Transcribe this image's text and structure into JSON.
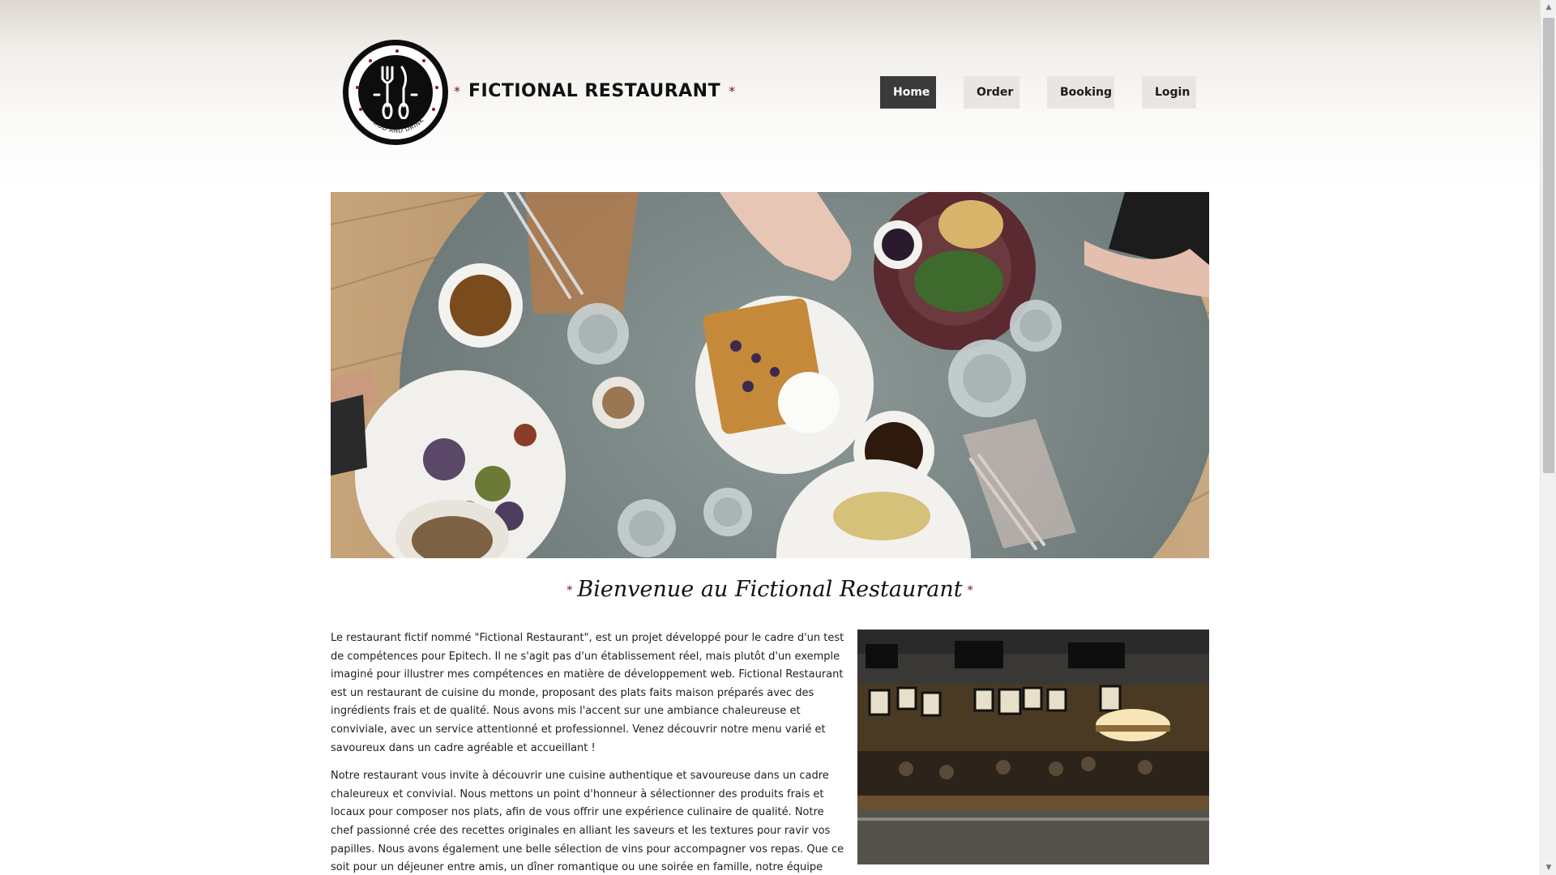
{
  "header": {
    "logo_text": "FOOD AND DRINK",
    "brand_name": "FICTIONAL RESTAURANT",
    "brand_star": "*"
  },
  "nav": {
    "items": [
      {
        "label": "Home",
        "active": true
      },
      {
        "label": "Order",
        "active": false
      },
      {
        "label": "Booking",
        "active": false
      },
      {
        "label": "Login",
        "active": false
      }
    ]
  },
  "welcome": {
    "title": "Bienvenue au Fictional Restaurant",
    "star": "*"
  },
  "content": {
    "paragraphs": [
      "Le restaurant fictif nommé \"Fictional Restaurant\", est un projet développé pour le cadre d'un test de compétences pour Epitech. Il ne s'agit pas d'un établissement réel, mais plutôt d'un exemple imaginé pour illustrer mes compétences en matière de développement web. Fictional Restaurant est un restaurant de cuisine du monde, proposant des plats faits maison préparés avec des ingrédients frais et de qualité. Nous avons mis l'accent sur une ambiance chaleureuse et conviviale, avec un service attentionné et professionnel. Venez découvrir notre menu varié et savoureux dans un cadre agréable et accueillant !",
      "Notre restaurant vous invite à découvrir une cuisine authentique et savoureuse dans un cadre chaleureux et convivial. Nous mettons un point d'honneur à sélectionner des produits frais et locaux pour composer nos plats, afin de vous offrir une expérience culinaire de qualité. Notre chef passionné crée des recettes originales en alliant les saveurs et les textures pour ravir vos papilles. Nous avons également une belle sélection de vins pour accompagner vos repas. Que ce soit pour un déjeuner entre amis, un dîner romantique ou une soirée en famille, notre équipe sera heureuse"
    ]
  },
  "icons": {
    "logo": "fork-knife-icon",
    "scroll_up": "chevron-up-icon",
    "scroll_down": "chevron-down-icon"
  },
  "colors": {
    "accent": "#7a1010",
    "nav_active_bg": "#3a3a3a",
    "nav_bg": "#e9e6e1"
  }
}
